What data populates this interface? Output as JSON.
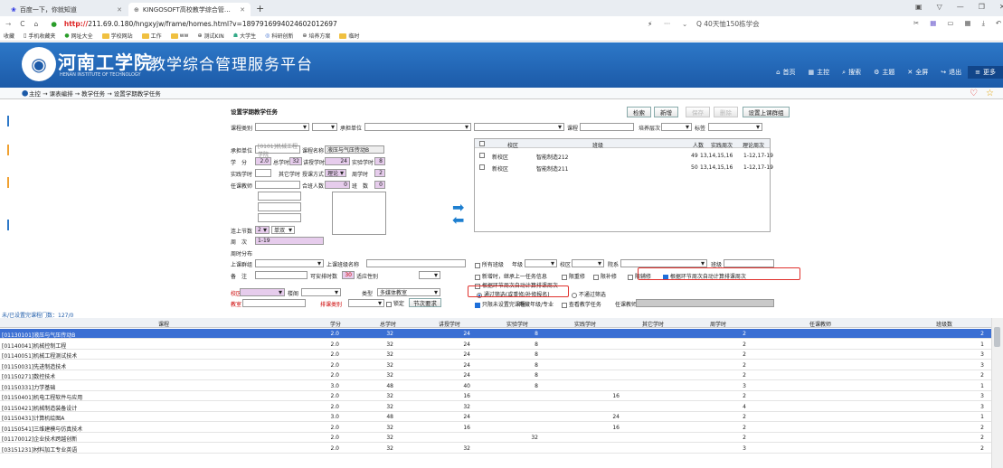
{
  "browser": {
    "tabs": [
      {
        "label": "百度一下，你就知道"
      },
      {
        "label": "KINGOSOFT高校教学综合管…"
      }
    ],
    "url_prefix": "http://",
    "url": "211.69.0.180/hngxyjw/frame/homes.html?v=1897916994024602012697",
    "search_text": "Q 40天恤150栋学会",
    "bookmarks": [
      "收藏",
      "手机收藏夹",
      "网址大全",
      "学校网站",
      "工作",
      "ww",
      "测试KIN",
      "大学生",
      "科研创新",
      "培养方案",
      "临时"
    ]
  },
  "app": {
    "school_name": "河南工学院",
    "school_en": "HENAN INSTITUTE OF TECHNOLOGY",
    "system_title": "教学综合管理服务平台",
    "nav": [
      {
        "icon": "home-icon",
        "label": "首页"
      },
      {
        "icon": "grid-icon",
        "label": "主控"
      },
      {
        "icon": "search-icon",
        "label": "搜索"
      },
      {
        "icon": "gear-icon",
        "label": "主题"
      },
      {
        "icon": "fullscreen-icon",
        "label": "全屏"
      },
      {
        "icon": "logout-icon",
        "label": "退出"
      },
      {
        "icon": "menu-icon",
        "label": "更多"
      }
    ],
    "breadcrumb": "主控 → 课表编排 → 教学任务 → 设置学期教学任务"
  },
  "form": {
    "title": "设置学期教学任务",
    "buttons": {
      "search": "检索",
      "new": "新增",
      "save": "保存",
      "delete": "删除",
      "set_week": "设置上课群组"
    },
    "row1": {
      "course_type": "课程类别",
      "dept": "承担单位",
      "course": "课程",
      "level": "培养层次",
      "tag": "标签"
    },
    "course_info": {
      "dept_label": "承担单位",
      "dept_value": "[0101]机械工程学院",
      "name_label": "课程名称",
      "name_value": "液压与气压传动B",
      "credit_label": "学　分",
      "credit": "2.0",
      "total_label": "总学时",
      "total": "32",
      "lecture_label": "讲授学时",
      "lecture": "24",
      "exp_label": "实验学时",
      "exp": "8",
      "practice_label": "实践学时",
      "practice": "",
      "other_label": "其它学时",
      "other": "",
      "method_label": "授课方式",
      "method": "理论",
      "week_label": "周学时",
      "week": "2",
      "teacher_label": "任课教师",
      "teacher": "",
      "merge_label": "合班人数",
      "merge": "0",
      "classcount_label": "班　数",
      "classcount": "0"
    },
    "section": {
      "label": "连上节数",
      "value": "2",
      "oddeven": "单双"
    },
    "weeks": {
      "label": "周　次",
      "value": "1-19"
    },
    "week_dist": "周时分布",
    "group": {
      "label": "上课群组",
      "class_name_label": "上课班级名称"
    },
    "remark": {
      "label": "备　注",
      "max_label": "可安排时数",
      "max": "30",
      "gender_label": "适应性别"
    },
    "campus": {
      "label": "校区",
      "building": "楼阁",
      "type_label": "类型",
      "type": "多媒体教室"
    },
    "room": {
      "label": "教室",
      "type_label": "排课类别",
      "lock": "锁定",
      "section_btn": "节次要求"
    },
    "class_table": {
      "headers": [
        "校区",
        "班级",
        "人数",
        "实践周次",
        "理论周次"
      ],
      "rows": [
        {
          "campus": "新校区",
          "class": "智能制造212",
          "count": "49",
          "practice": "13,14,15,16",
          "theory": "1-12,17-19"
        },
        {
          "campus": "新校区",
          "class": "智能制造211",
          "count": "50",
          "practice": "13,14,15,16",
          "theory": "1-12,17-19"
        }
      ]
    },
    "filters": {
      "all_classes": "所有班级",
      "grade": "年级",
      "campus": "校区",
      "dept": "院系",
      "class": "班级"
    },
    "options": {
      "new_inherit": "新增时，继承上一任务信息",
      "limit_rep": "限重修",
      "limit_sel": "限补修",
      "limit_assist": "限辅修",
      "auto_week": "根据环节周次自动计算排课周次",
      "auto_week2": "根据环节周次自动计算排课周次",
      "pass": "通过筛选(或重修/补修报名)",
      "nopass": "不通过筛选",
      "unset": "只限未设置完课程",
      "hide": "隐藏年级/专业",
      "view_all": "查看教学任务",
      "teacher": "任课教师"
    },
    "count_text": "未/已设置完课程门数：127/0"
  },
  "grid": {
    "headers": [
      "课程",
      "学分",
      "总学时",
      "讲授学时",
      "实验学时",
      "实践学时",
      "其它学时",
      "周学时",
      "任课教师",
      "班级数"
    ],
    "rows": [
      [
        "[01130101]液压与气压传动B",
        "2.0",
        "32",
        "24",
        "8",
        "",
        "",
        "2",
        "",
        "2"
      ],
      [
        "[01140041]机械控制工程",
        "2.0",
        "32",
        "24",
        "8",
        "",
        "",
        "2",
        "",
        "1"
      ],
      [
        "[01140051]机械工程测试技术",
        "2.0",
        "32",
        "24",
        "8",
        "",
        "",
        "2",
        "",
        "3"
      ],
      [
        "[01150031]先进制造技术",
        "2.0",
        "32",
        "24",
        "8",
        "",
        "",
        "2",
        "",
        "3"
      ],
      [
        "[01150271]数控技术",
        "2.0",
        "32",
        "24",
        "8",
        "",
        "",
        "2",
        "",
        "2"
      ],
      [
        "[01150331]力学基础",
        "3.0",
        "48",
        "40",
        "8",
        "",
        "",
        "3",
        "",
        "1"
      ],
      [
        "[01150401]机电工程软件与应用",
        "2.0",
        "32",
        "16",
        "",
        "16",
        "",
        "2",
        "",
        "3"
      ],
      [
        "[01150421]机械制造装备设计",
        "2.0",
        "32",
        "32",
        "",
        "",
        "",
        "4",
        "",
        "3"
      ],
      [
        "[01150431]计算机绘图A",
        "3.0",
        "48",
        "24",
        "",
        "24",
        "",
        "2",
        "",
        "1"
      ],
      [
        "[01150541]三维建模与仿真技术",
        "2.0",
        "32",
        "16",
        "",
        "16",
        "",
        "2",
        "",
        "2"
      ],
      [
        "[01170012]企业技术跨越创新",
        "2.0",
        "32",
        "",
        "32",
        "",
        "",
        "2",
        "",
        "2"
      ],
      [
        "[03151231]材料加工专业英语",
        "2.0",
        "32",
        "32",
        "",
        "",
        "",
        "3",
        "",
        "2"
      ]
    ]
  }
}
